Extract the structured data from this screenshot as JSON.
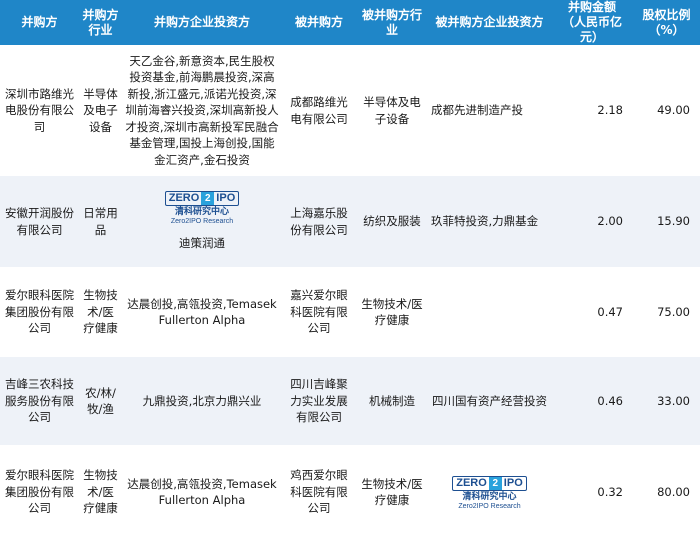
{
  "headers": {
    "acquirer": "并购方",
    "acquirer_industry": "并购方\n行业",
    "acquirer_investors": "并购方企业投资方",
    "target": "被并购方",
    "target_industry": "被并购方行业",
    "target_investors": "被并购方企业投资方",
    "amount": "并购金额\n（人民币亿元）",
    "stake": "股权比例\n（%）"
  },
  "rows": [
    {
      "acquirer": "深圳市路维光电股份有限公司",
      "acquirer_industry": "半导体及电子设备",
      "acquirer_investors": "天乙金谷,新意资本,民生股权投资基金,前海鹏晨投资,深高新投,浙江盛元,派诺光投资,深圳前海睿兴投资,深圳高新投人才投资,深圳市高新投军民融合基金管理,国投上海创投,国能金汇资产,金石投资",
      "target": "成都路维光电有限公司",
      "target_industry": "半导体及电子设备",
      "target_investors": "成都先进制造产投",
      "amount": "2.18",
      "stake": "49.00"
    },
    {
      "acquirer": "安徽开润股份有限公司",
      "acquirer_industry": "日常用品",
      "acquirer_investors": "迪策润通",
      "target": "上海嘉乐股份有限公司",
      "target_industry": "纺织及服装",
      "target_investors": "玖菲特投资,力鼎基金",
      "amount": "2.00",
      "stake": "15.90"
    },
    {
      "acquirer": "爱尔眼科医院集团股份有限公司",
      "acquirer_industry": "生物技术/医疗健康",
      "acquirer_investors": "达晨创投,高瓴投资,Temasek Fullerton Alpha",
      "target": "嘉兴爱尔眼科医院有限公司",
      "target_industry": "生物技术/医疗健康",
      "target_investors": "",
      "amount": "0.47",
      "stake": "75.00"
    },
    {
      "acquirer": "吉峰三农科技服务股份有限公司",
      "acquirer_industry": "农/林/牧/渔",
      "acquirer_investors": "九鼎投资,北京力鼎兴业",
      "target": "四川吉峰聚力实业发展有限公司",
      "target_industry": "机械制造",
      "target_investors": "四川国有资产经营投资",
      "amount": "0.46",
      "stake": "33.00"
    },
    {
      "acquirer": "爱尔眼科医院集团股份有限公司",
      "acquirer_industry": "生物技术/医疗健康",
      "acquirer_investors": "达晨创投,高瓴投资,Temasek Fullerton Alpha",
      "target": "鸡西爱尔眼科医院有限公司",
      "target_industry": "生物技术/医疗健康",
      "target_investors": "",
      "amount": "0.32",
      "stake": "80.00"
    }
  ],
  "watermark": {
    "logo_left": "ZERO",
    "logo_mid": "2",
    "logo_right": "IPO",
    "cn": "清科研究中心",
    "en": "Zero2IPO Research"
  },
  "colors": {
    "header_bg": "#1f86c8",
    "stripe_bg": "#eef2f8",
    "logo_blue": "#1d4f91",
    "logo_cyan": "#2aa2dc"
  }
}
